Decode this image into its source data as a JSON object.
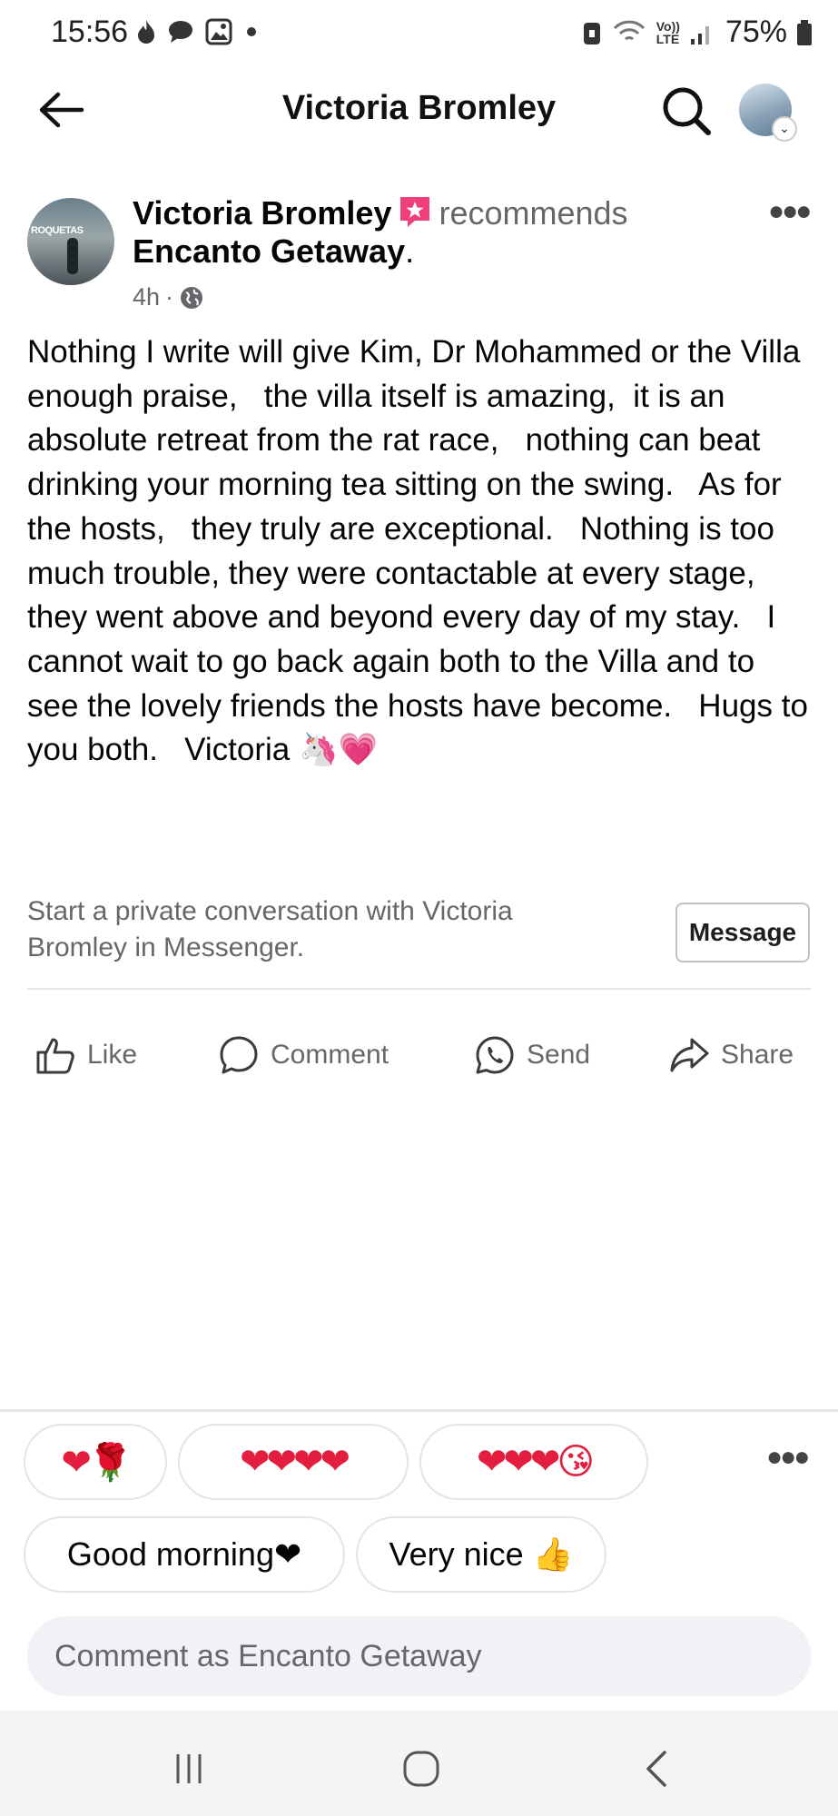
{
  "status_bar": {
    "time": "15:56",
    "network_label_top": "Vo))",
    "network_label_bottom": "LTE",
    "battery": "75%"
  },
  "header": {
    "title": "Victoria Bromley"
  },
  "post": {
    "author": "Victoria Bromley",
    "action_text": "recommends",
    "page_name": "Encanto Getaway",
    "time_ago": "4h",
    "separator": "·",
    "avatar_text": "ROQUETAS",
    "body": "Nothing I write will give Kim, Dr Mohammed or the Villa enough praise,   the villa itself is amazing,  it is an absolute retreat from the rat race,   nothing can beat drinking your morning tea sitting on the swing.   As for the hosts,   they truly are exceptional.   Nothing is too much trouble, they were contactable at every stage, they went above and beyond every day of my stay.   I cannot wait to go back again both to the Villa and to see the lovely friends the hosts have become.   Hugs to you both.   Victoria 🦄💗"
  },
  "messenger_prompt": {
    "text": "Start a private conversation with Victoria Bromley in Messenger.",
    "button_label": "Message"
  },
  "actions": {
    "like": "Like",
    "comment": "Comment",
    "send": "Send",
    "share": "Share"
  },
  "quick_replies": [
    {
      "text": "❤🌹"
    },
    {
      "text": "❤❤❤❤"
    },
    {
      "text": "❤❤❤😘"
    },
    {
      "text": "Good morning❤"
    },
    {
      "text": "Very nice 👍"
    }
  ],
  "comment_box": {
    "placeholder": "Comment as Encanto Getaway"
  },
  "colors": {
    "secondary_text": "#65676b",
    "heart_red": "#e41e3f",
    "badge_pink": "#f0407a",
    "input_bg": "#f0f2f5"
  }
}
